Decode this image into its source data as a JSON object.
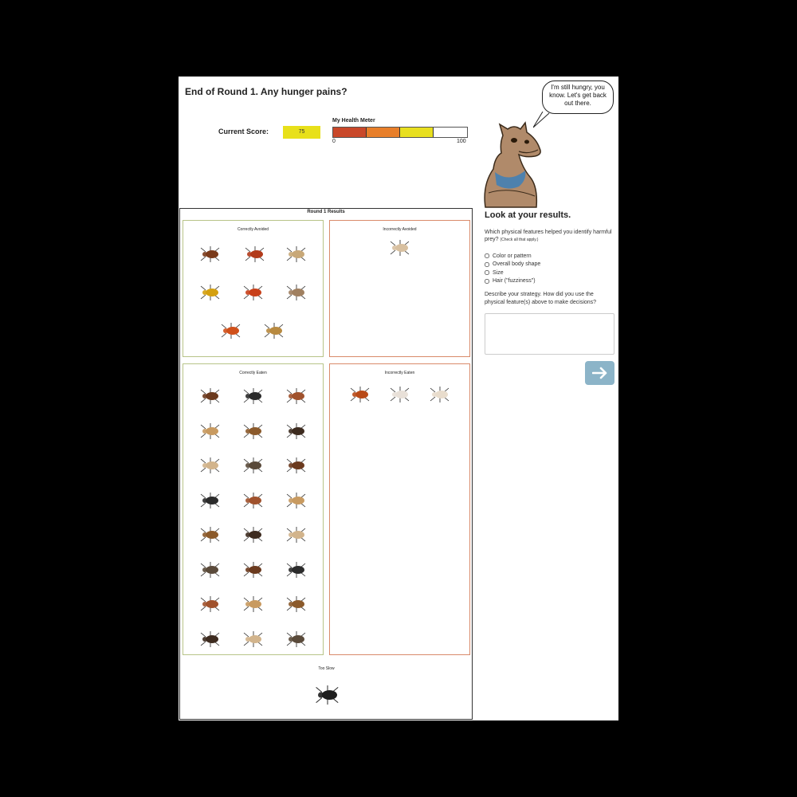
{
  "header": {
    "title": "End of Round 1. Any hunger pains?"
  },
  "score": {
    "label": "Current Score:",
    "value": "75"
  },
  "health_meter": {
    "label": "My Health Meter",
    "min_label": "0",
    "max_label": "100",
    "segment_colors": [
      "#c9482a",
      "#e87f2a",
      "#e8df1f",
      "#ffffff"
    ]
  },
  "mascot": {
    "speech": "I'm still hungry, you know. Let's get back out there."
  },
  "results": {
    "title": "Round 1 Results",
    "correctly_avoided": {
      "title": "Correctly Avoided",
      "count": 8
    },
    "incorrectly_avoided": {
      "title": "Incorrectly Avoided",
      "count": 1
    },
    "correctly_eaten": {
      "title": "Correctly Eaten",
      "count": 24
    },
    "incorrectly_eaten": {
      "title": "Incorrectly Eaten",
      "count": 3
    },
    "too_slow": {
      "title": "Too Slow",
      "count": 1
    }
  },
  "sidebar": {
    "title": "Look at your results.",
    "question1": "Which physical features helped you identify harmful prey?",
    "question1_note": "(Check all that apply.)",
    "options": [
      {
        "label": "Color or pattern",
        "checked": false
      },
      {
        "label": "Overall body shape",
        "checked": false
      },
      {
        "label": "Size",
        "checked": false
      },
      {
        "label": "Hair (\"fuzziness\")",
        "checked": false
      }
    ],
    "question2": "Describe your strategy. How did you use the physical feature(s) above to make decisions?",
    "answer_value": "",
    "next_icon": "arrow-right-icon"
  }
}
